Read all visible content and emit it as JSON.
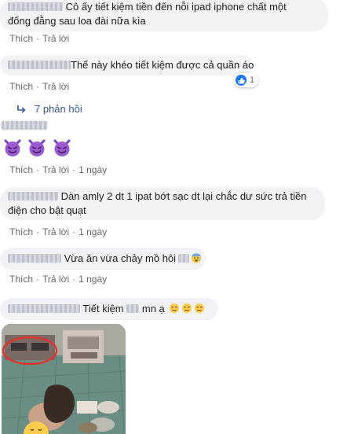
{
  "actions": {
    "like": "Thích",
    "reply": "Trả lời",
    "sep": "·"
  },
  "comments": [
    {
      "line1": "Cô ấy tiết kiệm tiền đến nỗi ipad iphone chất một",
      "line2": "đống đằng sau loa đài nữa kìa"
    },
    {
      "text": "Thế này khéo tiết kiệm được cả quần áo",
      "reaction_count": "1",
      "replies_label": "7 phản hồi"
    },
    {
      "time": "1 ngày",
      "emoji": [
        "smiling-imp",
        "smiling-imp",
        "smiling-imp"
      ]
    },
    {
      "line1": "Dàn amly 2 dt 1 ipat bớt sạc dt lại chắc dư sức trả tiền",
      "line2": "điện cho bật quạt",
      "time": "1 ngày"
    },
    {
      "text": "Vừa ăn vừa chảy mồ hôi",
      "time": "1 ngày",
      "emoji": "anxious-sweat"
    },
    {
      "text_a": "Tiết kiệm",
      "text_b": "mn ạ",
      "emoji": [
        "unamused",
        "unamused",
        "unamused"
      ]
    }
  ],
  "colors": {
    "bubble": "#f0f2f5",
    "link": "#385898",
    "meta": "#65676b",
    "like": "#1877f2",
    "highlight_circle": "#e0342a"
  }
}
